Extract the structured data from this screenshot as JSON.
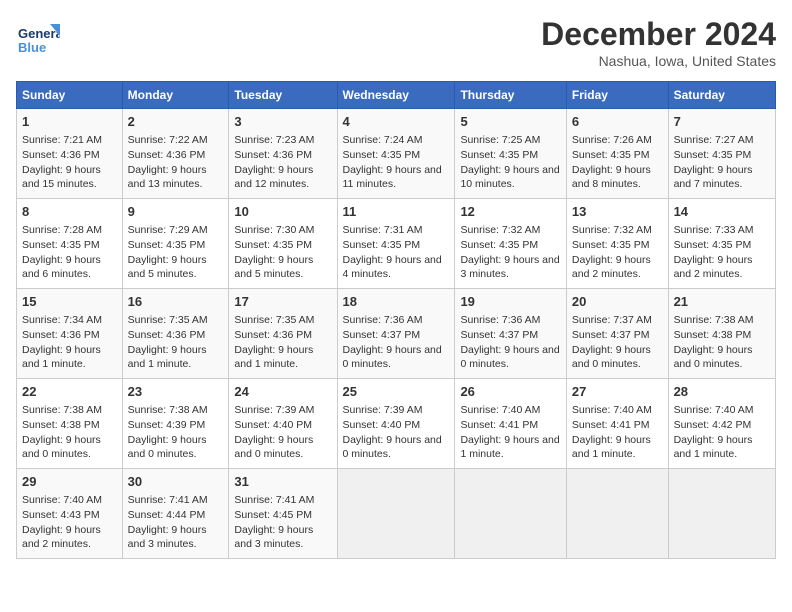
{
  "header": {
    "logo_general": "General",
    "logo_blue": "Blue",
    "month_title": "December 2024",
    "location": "Nashua, Iowa, United States"
  },
  "days_of_week": [
    "Sunday",
    "Monday",
    "Tuesday",
    "Wednesday",
    "Thursday",
    "Friday",
    "Saturday"
  ],
  "weeks": [
    [
      {
        "day": "1",
        "sunrise": "7:21 AM",
        "sunset": "4:36 PM",
        "daylight": "9 hours and 15 minutes."
      },
      {
        "day": "2",
        "sunrise": "7:22 AM",
        "sunset": "4:36 PM",
        "daylight": "9 hours and 13 minutes."
      },
      {
        "day": "3",
        "sunrise": "7:23 AM",
        "sunset": "4:36 PM",
        "daylight": "9 hours and 12 minutes."
      },
      {
        "day": "4",
        "sunrise": "7:24 AM",
        "sunset": "4:35 PM",
        "daylight": "9 hours and 11 minutes."
      },
      {
        "day": "5",
        "sunrise": "7:25 AM",
        "sunset": "4:35 PM",
        "daylight": "9 hours and 10 minutes."
      },
      {
        "day": "6",
        "sunrise": "7:26 AM",
        "sunset": "4:35 PM",
        "daylight": "9 hours and 8 minutes."
      },
      {
        "day": "7",
        "sunrise": "7:27 AM",
        "sunset": "4:35 PM",
        "daylight": "9 hours and 7 minutes."
      }
    ],
    [
      {
        "day": "8",
        "sunrise": "7:28 AM",
        "sunset": "4:35 PM",
        "daylight": "9 hours and 6 minutes."
      },
      {
        "day": "9",
        "sunrise": "7:29 AM",
        "sunset": "4:35 PM",
        "daylight": "9 hours and 5 minutes."
      },
      {
        "day": "10",
        "sunrise": "7:30 AM",
        "sunset": "4:35 PM",
        "daylight": "9 hours and 5 minutes."
      },
      {
        "day": "11",
        "sunrise": "7:31 AM",
        "sunset": "4:35 PM",
        "daylight": "9 hours and 4 minutes."
      },
      {
        "day": "12",
        "sunrise": "7:32 AM",
        "sunset": "4:35 PM",
        "daylight": "9 hours and 3 minutes."
      },
      {
        "day": "13",
        "sunrise": "7:32 AM",
        "sunset": "4:35 PM",
        "daylight": "9 hours and 2 minutes."
      },
      {
        "day": "14",
        "sunrise": "7:33 AM",
        "sunset": "4:35 PM",
        "daylight": "9 hours and 2 minutes."
      }
    ],
    [
      {
        "day": "15",
        "sunrise": "7:34 AM",
        "sunset": "4:36 PM",
        "daylight": "9 hours and 1 minute."
      },
      {
        "day": "16",
        "sunrise": "7:35 AM",
        "sunset": "4:36 PM",
        "daylight": "9 hours and 1 minute."
      },
      {
        "day": "17",
        "sunrise": "7:35 AM",
        "sunset": "4:36 PM",
        "daylight": "9 hours and 1 minute."
      },
      {
        "day": "18",
        "sunrise": "7:36 AM",
        "sunset": "4:37 PM",
        "daylight": "9 hours and 0 minutes."
      },
      {
        "day": "19",
        "sunrise": "7:36 AM",
        "sunset": "4:37 PM",
        "daylight": "9 hours and 0 minutes."
      },
      {
        "day": "20",
        "sunrise": "7:37 AM",
        "sunset": "4:37 PM",
        "daylight": "9 hours and 0 minutes."
      },
      {
        "day": "21",
        "sunrise": "7:38 AM",
        "sunset": "4:38 PM",
        "daylight": "9 hours and 0 minutes."
      }
    ],
    [
      {
        "day": "22",
        "sunrise": "7:38 AM",
        "sunset": "4:38 PM",
        "daylight": "9 hours and 0 minutes."
      },
      {
        "day": "23",
        "sunrise": "7:38 AM",
        "sunset": "4:39 PM",
        "daylight": "9 hours and 0 minutes."
      },
      {
        "day": "24",
        "sunrise": "7:39 AM",
        "sunset": "4:40 PM",
        "daylight": "9 hours and 0 minutes."
      },
      {
        "day": "25",
        "sunrise": "7:39 AM",
        "sunset": "4:40 PM",
        "daylight": "9 hours and 0 minutes."
      },
      {
        "day": "26",
        "sunrise": "7:40 AM",
        "sunset": "4:41 PM",
        "daylight": "9 hours and 1 minute."
      },
      {
        "day": "27",
        "sunrise": "7:40 AM",
        "sunset": "4:41 PM",
        "daylight": "9 hours and 1 minute."
      },
      {
        "day": "28",
        "sunrise": "7:40 AM",
        "sunset": "4:42 PM",
        "daylight": "9 hours and 1 minute."
      }
    ],
    [
      {
        "day": "29",
        "sunrise": "7:40 AM",
        "sunset": "4:43 PM",
        "daylight": "9 hours and 2 minutes."
      },
      {
        "day": "30",
        "sunrise": "7:41 AM",
        "sunset": "4:44 PM",
        "daylight": "9 hours and 3 minutes."
      },
      {
        "day": "31",
        "sunrise": "7:41 AM",
        "sunset": "4:45 PM",
        "daylight": "9 hours and 3 minutes."
      },
      null,
      null,
      null,
      null
    ]
  ]
}
